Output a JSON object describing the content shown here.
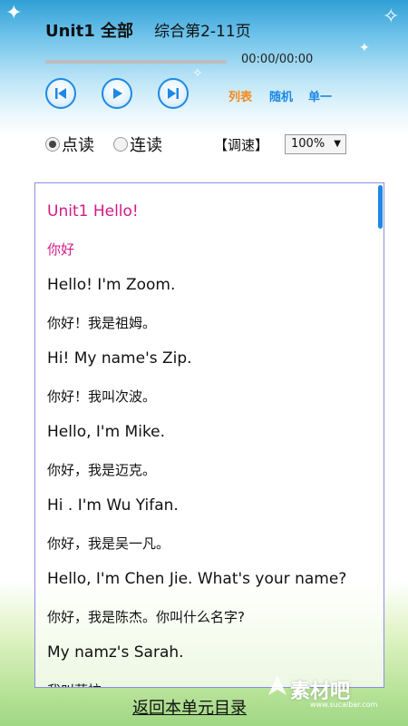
{
  "header": {
    "title": "Unit1 全部",
    "subtitle": "综合第2-11页"
  },
  "player": {
    "time": "00:00/00:00",
    "progress": 0,
    "prev_icon": "skip-previous-icon",
    "play_icon": "play-icon",
    "next_icon": "skip-next-icon",
    "modes": [
      "列表",
      "随机",
      "单一"
    ],
    "mode_colors": [
      "#f28a1a",
      "#1e88e5",
      "#1e88e5"
    ]
  },
  "options": {
    "read_single": "点读",
    "read_continuous": "连读",
    "speed_label": "【调速】",
    "speed_value": "100%"
  },
  "content": {
    "lines": [
      {
        "text": "Unit1 Hello!",
        "lang": "en",
        "highlight": true
      },
      {
        "text": "你好",
        "lang": "cn",
        "highlight": true
      },
      {
        "text": "Hello! I'm Zoom.",
        "lang": "en",
        "highlight": false
      },
      {
        "text": "你好！我是祖姆。",
        "lang": "cn",
        "highlight": false
      },
      {
        "text": "Hi! My name's Zip.",
        "lang": "en",
        "highlight": false
      },
      {
        "text": "你好！我叫次波。",
        "lang": "cn",
        "highlight": false
      },
      {
        "text": "Hello, I'm Mike.",
        "lang": "en",
        "highlight": false
      },
      {
        "text": "你好，我是迈克。",
        "lang": "cn",
        "highlight": false
      },
      {
        "text": "Hi . I'm Wu Yifan.",
        "lang": "en",
        "highlight": false
      },
      {
        "text": "你好，我是吴一凡。",
        "lang": "cn",
        "highlight": false
      },
      {
        "text": "Hello, I'm Chen Jie. What's your name?",
        "lang": "en",
        "highlight": false
      },
      {
        "text": "你好，我是陈杰。你叫什么名字?",
        "lang": "cn",
        "highlight": false
      },
      {
        "text": "My namz's Sarah.",
        "lang": "en",
        "highlight": false
      },
      {
        "text": "我叫萨拉。",
        "lang": "cn",
        "highlight": false
      }
    ]
  },
  "footer": {
    "back_link": "返回本单元目录",
    "watermark": "素材吧",
    "watermark_url": "www.sucaibar.com"
  },
  "colors": {
    "accent": "#1e88e5",
    "highlight": "#d11a86",
    "border": "#8a8fe0"
  }
}
